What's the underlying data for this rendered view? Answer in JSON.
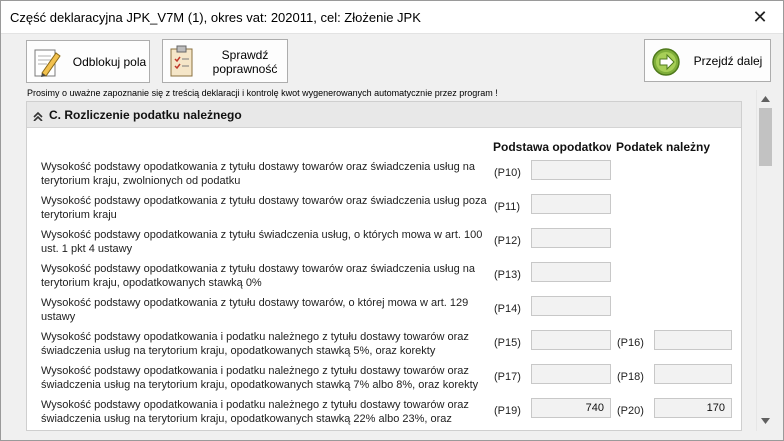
{
  "window": {
    "title": "Część deklaracyjna JPK_V7M (1), okres vat: 202011, cel: Złożenie JPK",
    "close_glyph": "✕"
  },
  "toolbar": {
    "unlock_label": "Odblokuj pola",
    "check_label_line1": "Sprawdź",
    "check_label_line2": "poprawność",
    "next_label": "Przejdź dalej",
    "unlock_icon": "pencil-paper-icon",
    "check_icon": "clipboard-check-icon",
    "next_icon": "arrow-right-circle-icon"
  },
  "notice": "Prosimy o uważne zapoznanie się z treścią deklaracji i kontrolę kwot wygenerowanych automatycznie przez program !",
  "section": {
    "title": "C. Rozliczenie podatku należnego",
    "col_base": "Podstawa opodatkowania",
    "col_tax": "Podatek należny"
  },
  "rows": [
    {
      "line1": "Wysokość podstawy opodatkowania z tytułu dostawy towarów oraz świadczenia usług na",
      "line2": "terytorium kraju, zwolnionych od podatku",
      "base_code": "(P10)",
      "base_value": "",
      "tax_code": "",
      "tax_value": ""
    },
    {
      "line1": "Wysokość podstawy opodatkowania z tytułu dostawy towarów oraz świadczenia usług poza",
      "line2": "terytorium kraju",
      "base_code": "(P11)",
      "base_value": "",
      "tax_code": "",
      "tax_value": ""
    },
    {
      "line1": "Wysokość podstawy opodatkowania z tytułu świadczenia usług, o których mowa w art. 100",
      "line2": "ust. 1 pkt 4 ustawy",
      "base_code": "(P12)",
      "base_value": "",
      "tax_code": "",
      "tax_value": ""
    },
    {
      "line1": "Wysokość podstawy opodatkowania z tytułu dostawy towarów oraz świadczenia usług na",
      "line2": "terytorium kraju, opodatkowanych stawką 0%",
      "base_code": "(P13)",
      "base_value": "",
      "tax_code": "",
      "tax_value": ""
    },
    {
      "line1": "Wysokość podstawy opodatkowania z tytułu dostawy towarów, o której mowa w art. 129",
      "line2": "ustawy",
      "base_code": "(P14)",
      "base_value": "",
      "tax_code": "",
      "tax_value": ""
    },
    {
      "line1": "Wysokość podstawy opodatkowania i podatku należnego z tytułu dostawy towarów oraz",
      "line2": "świadczenia usług na terytorium kraju, opodatkowanych stawką 5%, oraz korekty",
      "base_code": "(P15)",
      "base_value": "",
      "tax_code": "(P16)",
      "tax_value": ""
    },
    {
      "line1": "Wysokość podstawy opodatkowania i podatku należnego z tytułu dostawy towarów oraz",
      "line2": "świadczenia usług na terytorium kraju, opodatkowanych stawką 7% albo 8%, oraz korekty",
      "base_code": "(P17)",
      "base_value": "",
      "tax_code": "(P18)",
      "tax_value": ""
    },
    {
      "line1": "Wysokość podstawy opodatkowania i podatku należnego z tytułu dostawy towarów oraz",
      "line2": "świadczenia usług na terytorium kraju, opodatkowanych stawką 22% albo 23%, oraz",
      "base_code": "(P19)",
      "base_value": "740",
      "tax_code": "(P20)",
      "tax_value": "170"
    }
  ]
}
